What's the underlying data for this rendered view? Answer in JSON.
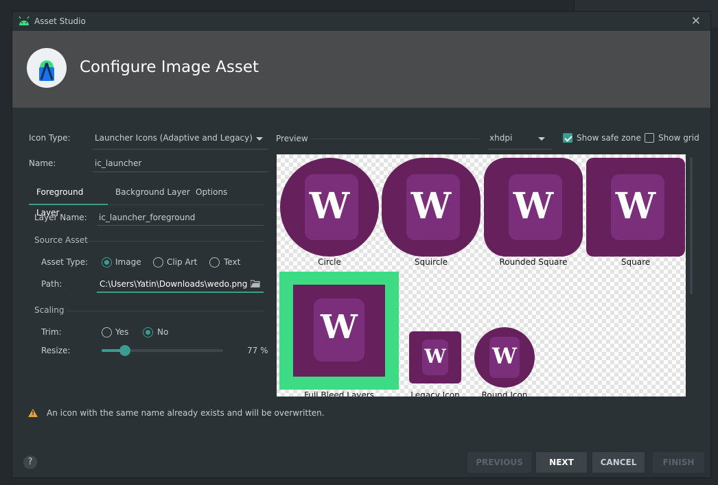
{
  "window": {
    "title": "Asset Studio"
  },
  "banner": {
    "heading": "Configure Image Asset"
  },
  "form": {
    "icon_type_label": "Icon Type:",
    "icon_type_value": "Launcher Icons (Adaptive and Legacy)",
    "name_label": "Name:",
    "name_value": "ic_launcher"
  },
  "tabs": [
    {
      "label": "Foreground Layer",
      "active": true
    },
    {
      "label": "Background Layer",
      "active": false
    },
    {
      "label": "Options",
      "active": false
    }
  ],
  "layer": {
    "layer_name_label": "Layer Name:",
    "layer_name_value": "ic_launcher_foreground",
    "source_asset_section": "Source Asset",
    "asset_type_label": "Asset Type:",
    "asset_type_options": [
      "Image",
      "Clip Art",
      "Text"
    ],
    "asset_type_selected": "Image",
    "path_label": "Path:",
    "path_value": "C:\\Users\\Yatin\\Downloads\\wedo.png",
    "scaling_section": "Scaling",
    "trim_label": "Trim:",
    "trim_options": [
      "Yes",
      "No"
    ],
    "trim_selected": "No",
    "resize_label": "Resize:",
    "resize_value": 77,
    "resize_text": "77 %"
  },
  "preview": {
    "label": "Preview",
    "density": "xhdpi",
    "show_safe_zone_label": "Show safe zone",
    "show_safe_zone": true,
    "show_grid_label": "Show grid",
    "show_grid": false,
    "glyph": "W",
    "captions": {
      "circle": "Circle",
      "squircle": "Squircle",
      "rounded_square": "Rounded Square",
      "square": "Square",
      "full_bleed": "Full Bleed Layers",
      "legacy": "Legacy Icon",
      "round": "Round Icon"
    }
  },
  "warning": "An icon with the same name already exists and will be overwritten.",
  "buttons": {
    "help": "?",
    "previous": "PREVIOUS",
    "next": "NEXT",
    "cancel": "CANCEL",
    "finish": "FINISH"
  },
  "colors": {
    "accent": "#3a9d8f",
    "icon_background": "#66205c",
    "icon_foreground": "#7b2e7a",
    "full_bleed_border": "#3ddc84",
    "warning": "#e3a33a"
  }
}
